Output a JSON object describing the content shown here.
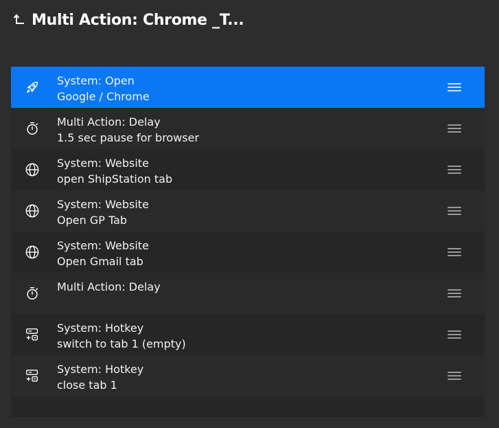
{
  "header": {
    "title": "Multi Action: Chrome _T..."
  },
  "actions": [
    {
      "title": "System: Open",
      "subtitle": "Google / Chrome",
      "icon": "rocket-icon"
    },
    {
      "title": "Multi Action: Delay",
      "subtitle": "1.5 sec pause for browser",
      "icon": "stopwatch-icon"
    },
    {
      "title": "System: Website",
      "subtitle": "open ShipStation tab",
      "icon": "globe-icon"
    },
    {
      "title": "System: Website",
      "subtitle": "Open GP Tab",
      "icon": "globe-icon"
    },
    {
      "title": "System: Website",
      "subtitle": "Open Gmail tab",
      "icon": "globe-icon"
    },
    {
      "title": "Multi Action: Delay",
      "subtitle": "",
      "icon": "stopwatch-icon"
    },
    {
      "title": "System: Hotkey",
      "subtitle": "switch to tab 1 (empty)",
      "icon": "hotkey-icon"
    },
    {
      "title": "System: Hotkey",
      "subtitle": "close tab 1",
      "icon": "hotkey-icon"
    }
  ],
  "colors": {
    "background": "#2d2d2d",
    "selected": "#0a78f5",
    "row_dark": "#262626",
    "row_light": "#2a2a2a"
  }
}
